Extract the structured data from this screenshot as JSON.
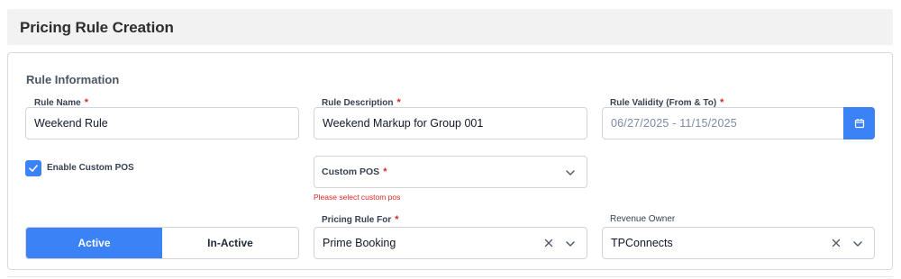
{
  "header": {
    "title": "Pricing Rule Creation"
  },
  "section": {
    "title": "Rule Information"
  },
  "rule_name": {
    "label": "Rule Name",
    "required_mark": "*",
    "value": "Weekend Rule"
  },
  "rule_description": {
    "label": "Rule Description",
    "required_mark": "*",
    "value": "Weekend Markup for Group 001"
  },
  "rule_validity": {
    "label": "Rule Validity (From & To)",
    "required_mark": "*",
    "value": "06/27/2025 - 11/15/2025",
    "icon": "calendar-icon",
    "button_color": "#3b82f6"
  },
  "custom_pos_toggle": {
    "label": "Enable Custom POS",
    "checked": true
  },
  "custom_pos": {
    "placeholder": "Custom POS",
    "required_mark": "*",
    "error": "Please select custom pos",
    "icon": "chevron-down-icon"
  },
  "status": {
    "options": [
      "Active",
      "In-Active"
    ],
    "selected": "Active",
    "accent": "#3b82f6"
  },
  "pricing_rule_for": {
    "label": "Pricing Rule For",
    "required_mark": "*",
    "value": "Prime Booking",
    "icons": [
      "clear-icon",
      "chevron-down-icon"
    ]
  },
  "revenue_owner": {
    "label": "Revenue Owner",
    "value": "TPConnects",
    "icons": [
      "clear-icon",
      "chevron-down-icon"
    ]
  }
}
